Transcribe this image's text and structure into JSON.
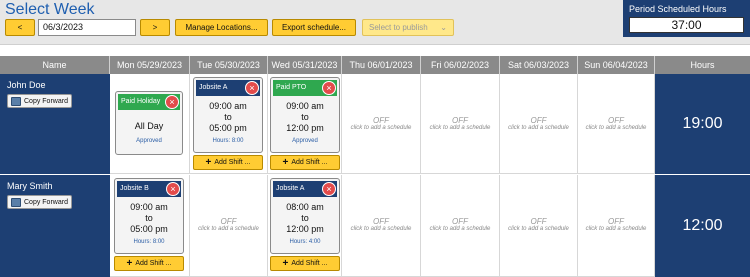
{
  "header": {
    "title": "Select Week",
    "prev_label": "<",
    "date_value": "06/3/2023",
    "next_label": ">",
    "manage_label": "Manage Locations...",
    "export_label": "Export schedule...",
    "publish_label": "Select to publish",
    "publish_arrow": "⌄"
  },
  "period": {
    "label": "Period Scheduled Hours",
    "value": "37:00"
  },
  "columns": {
    "name": "Name",
    "mon": "Mon 05/29/2023",
    "tue": "Tue 05/30/2023",
    "wed": "Wed 05/31/2023",
    "thu": "Thu 06/01/2023",
    "fri": "Fri 06/02/2023",
    "sat": "Sat 06/03/2023",
    "sun": "Sun 06/04/2023",
    "hours": "Hours"
  },
  "common": {
    "off": "OFF",
    "off_hint": "click to add a schedule",
    "copy_forward": "Copy Forward",
    "add_shift": "Add Shift ...",
    "x": "×",
    "plus": "+",
    "to": "to"
  },
  "employees": [
    {
      "name": "John Doe",
      "total": "19:00",
      "mon": {
        "head": "Paid Holiday",
        "line1": "All Day",
        "note": "Approved"
      },
      "tue": {
        "head": "Jobsite A",
        "start": "09:00 am",
        "end": "05:00 pm",
        "note": "Hours: 8:00"
      },
      "wed": {
        "head": "Paid PTO",
        "start": "09:00 am",
        "end": "12:00 pm",
        "note": "Approved"
      }
    },
    {
      "name": "Mary Smith",
      "total": "12:00",
      "mon": {
        "head": "Jobsite B",
        "start": "09:00 am",
        "end": "05:00 pm",
        "note": "Hours: 8:00"
      },
      "wed": {
        "head": "Jobsite A",
        "start": "08:00 am",
        "end": "12:00 pm",
        "note": "Hours: 4:00"
      }
    }
  ],
  "colors": {
    "navy": "#1d3f73",
    "accent_yellow": "#ffcc33",
    "green": "#2fa84f",
    "red": "#e34b4b",
    "title_blue": "#1f5fb0"
  }
}
